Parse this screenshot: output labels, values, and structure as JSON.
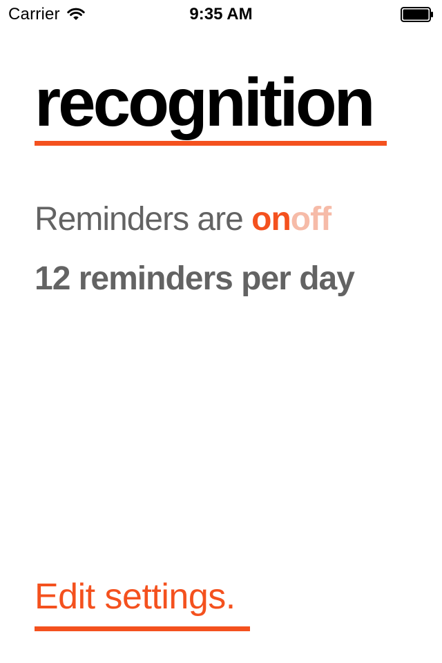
{
  "status_bar": {
    "carrier": "Carrier",
    "time": "9:35 AM",
    "wifi_icon": "wifi-icon",
    "battery_icon": "battery-icon"
  },
  "title": "recognition",
  "reminders": {
    "prefix": "Reminders are ",
    "on_label": "on",
    "off_label": "off",
    "count_text": "12 reminders per day"
  },
  "edit_settings_label": "Edit settings.",
  "colors": {
    "accent": "#f4511e",
    "accent_faded": "#f6bba8",
    "body_text": "#636363",
    "title_text": "#000000"
  }
}
